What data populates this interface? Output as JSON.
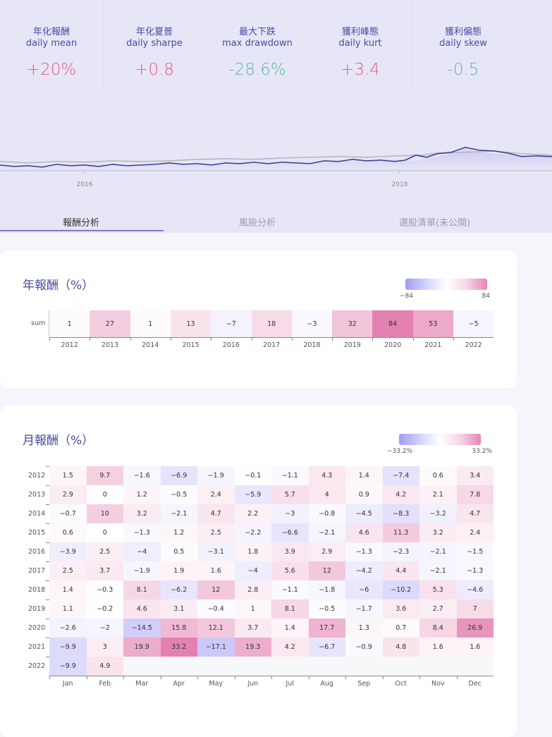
{
  "stats": [
    {
      "zh": "年化報酬",
      "en": "daily mean",
      "value": "+20%",
      "color": "#e45a8a"
    },
    {
      "zh": "年化夏普",
      "en": "daily sharpe",
      "value": "+0.8",
      "color": "#e45a8a"
    },
    {
      "zh": "最大下跌",
      "en": "max drawdown",
      "value": "-28.6%",
      "color": "#5bb8a0"
    },
    {
      "zh": "獲利峰態",
      "en": "daily kurt",
      "value": "+3.4",
      "color": "#e45a8a"
    },
    {
      "zh": "獲利偏態",
      "en": "daily skew",
      "value": "-0.5",
      "color": "#5bb8a0"
    }
  ],
  "equity_chart": {
    "x_ticks": [
      "2016",
      "2018"
    ]
  },
  "tabs": [
    {
      "label": "報酬分析",
      "active": true
    },
    {
      "label": "風險分析",
      "active": false
    },
    {
      "label": "選股清單(未公開)",
      "active": false
    }
  ],
  "annual": {
    "title": "年報酬（%）",
    "legend_min": "−84",
    "legend_max": "84",
    "row_label": "sum",
    "years": [
      "2012",
      "2013",
      "2014",
      "2015",
      "2016",
      "2017",
      "2018",
      "2019",
      "2020",
      "2021",
      "2022"
    ],
    "values": [
      "1",
      "27",
      "1",
      "13",
      "−7",
      "18",
      "−3",
      "32",
      "84",
      "53",
      "−5"
    ]
  },
  "monthly": {
    "title": "月報酬（%）",
    "legend_min": "−33.2%",
    "legend_max": "33.2%",
    "months": [
      "Jan",
      "Feb",
      "Mar",
      "Apr",
      "May",
      "Jun",
      "Jul",
      "Aug",
      "Sep",
      "Oct",
      "Nov",
      "Dec"
    ],
    "years": [
      "2012",
      "2013",
      "2014",
      "2015",
      "2016",
      "2017",
      "2018",
      "2019",
      "2020",
      "2021",
      "2022"
    ],
    "rows": [
      [
        "1.5",
        "9.7",
        "−1.6",
        "−6.9",
        "−1.9",
        "−0.1",
        "−1.1",
        "4.3",
        "1.4",
        "−7.4",
        "0.6",
        "3.4"
      ],
      [
        "2.9",
        "0",
        "1.2",
        "−0.5",
        "2.4",
        "−5.9",
        "5.7",
        "4",
        "0.9",
        "4.2",
        "2.1",
        "7.8"
      ],
      [
        "−0.7",
        "10",
        "3.2",
        "−2.1",
        "4.7",
        "2.2",
        "−3",
        "−0.8",
        "−4.5",
        "−8.3",
        "−3.2",
        "4.7"
      ],
      [
        "0.6",
        "0",
        "−1.3",
        "1.2",
        "2.5",
        "−2.2",
        "−6.6",
        "−2.1",
        "4.6",
        "11.3",
        "3.2",
        "2.4"
      ],
      [
        "−3.9",
        "2.5",
        "−4",
        "0.5",
        "−3.1",
        "1.8",
        "3.9",
        "2.9",
        "−1.3",
        "−2.3",
        "−2.1",
        "−1.5"
      ],
      [
        "2.5",
        "3.7",
        "−1.9",
        "1.9",
        "1.6",
        "−4",
        "5.6",
        "12",
        "−4.2",
        "4.4",
        "−2.1",
        "−1.3"
      ],
      [
        "1.4",
        "−0.3",
        "8.1",
        "−6.2",
        "12",
        "2.8",
        "−1.1",
        "−1.8",
        "−6",
        "−10.2",
        "5.3",
        "−4.6"
      ],
      [
        "1.1",
        "−0.2",
        "4.6",
        "3.1",
        "−0.4",
        "1",
        "8.1",
        "−0.5",
        "−1.7",
        "3.6",
        "2.7",
        "7"
      ],
      [
        "−2.6",
        "−2",
        "−14.5",
        "15.8",
        "12.1",
        "3.7",
        "1.4",
        "17.7",
        "1.3",
        "0.7",
        "8.4",
        "26.9"
      ],
      [
        "−9.9",
        "3",
        "19.9",
        "33.2",
        "−17.1",
        "19.3",
        "4.2",
        "−6.7",
        "−0.9",
        "4.8",
        "1.6",
        "1.6"
      ],
      [
        "−9.9",
        "4.9",
        "",
        "",
        "",
        "",
        "",
        "",
        "",
        "",
        "",
        ""
      ]
    ]
  }
}
